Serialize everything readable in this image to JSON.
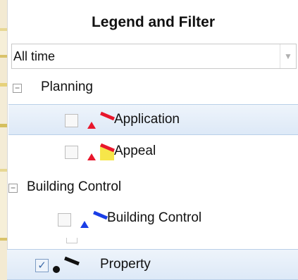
{
  "panel": {
    "title": "Legend and Filter"
  },
  "filter": {
    "selected": "All time"
  },
  "groups": [
    {
      "label": "Planning",
      "expanded": true,
      "items": [
        {
          "label": "Application",
          "checked": false,
          "marker": "red-triangle",
          "line_color": "#e8172c",
          "highlighted": true
        },
        {
          "label": "Appeal",
          "checked": false,
          "marker": "red-triangle",
          "line_color": "#e8172c",
          "fill_color": "#f6e64a",
          "highlighted": false
        }
      ]
    },
    {
      "label": "Building Control",
      "expanded": true,
      "items": [
        {
          "label": "Building Control",
          "checked": false,
          "marker": "blue-triangle",
          "line_color": "#1a3ee6",
          "highlighted": false
        }
      ]
    }
  ],
  "standalone": {
    "label": "Property",
    "checked": true,
    "marker": "black-dot",
    "line_color": "#111111",
    "highlighted": true
  },
  "toggle_symbol": "−",
  "checkmark": "✓",
  "dropdown_arrow": "▼"
}
